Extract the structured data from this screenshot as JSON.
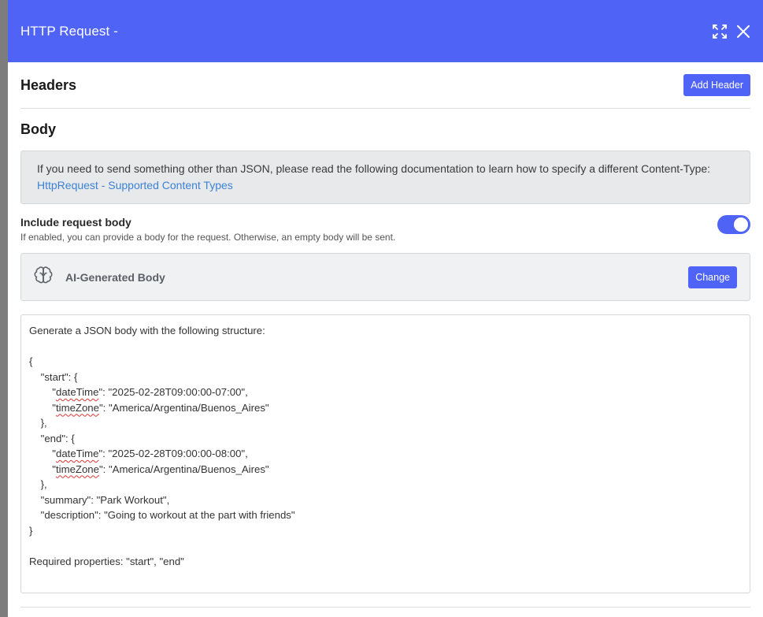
{
  "modal": {
    "title": "HTTP Request -",
    "actions": {
      "expand_icon": "expand-icon",
      "close_icon": "close-icon"
    }
  },
  "headers_section": {
    "title": "Headers",
    "add_button": "Add Header"
  },
  "body_section": {
    "title": "Body",
    "info_text": "If you need to send something other than JSON, please read the following documentation to learn how to specify a different Content-Type:",
    "info_link": "HttpRequest - Supported Content Types",
    "include_body": {
      "label": "Include request body",
      "help": "If enabled, you can provide a body for the request. Otherwise, an empty body will be sent.",
      "enabled": true
    },
    "ai_body": {
      "icon": "brain-icon",
      "title": "AI-Generated Body",
      "change_button": "Change"
    },
    "prompt_lines": {
      "l1": "Generate a JSON body with the following structure:",
      "l2": "",
      "l3": "{",
      "l4": "    \"start\": {",
      "l5a": "        \"",
      "l5b": "dateTime",
      "l5c": "\": \"2025-02-28T09:00:00-07:00\",",
      "l6a": "        \"",
      "l6b": "timeZone",
      "l6c": "\": \"America/Argentina/Buenos_Aires\"",
      "l7": "    },",
      "l8": "    \"end\": {",
      "l9a": "        \"",
      "l9b": "dateTime",
      "l9c": "\": \"2025-02-28T09:00:00-08:00\",",
      "l10a": "        \"",
      "l10b": "timeZone",
      "l10c": "\": \"America/Argentina/Buenos_Aires\"",
      "l11": "    },",
      "l12": "    \"summary\": \"Park Workout\",",
      "l13": "    \"description\": \"Going to workout at the part with friends\"",
      "l14": "}",
      "l15": "",
      "l16": "Required properties: \"start\", \"end\""
    }
  },
  "colors": {
    "accent": "#4f63f6",
    "link": "#3b82d6"
  }
}
